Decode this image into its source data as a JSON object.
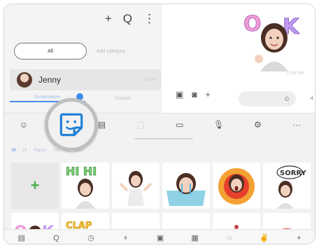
{
  "left_pane": {
    "top_actions": [
      "+",
      "Q",
      "⋮"
    ],
    "filter_pill": "All",
    "filter_link": "Add category",
    "contact": {
      "name": "Jenny",
      "time": "12:45"
    },
    "tabs": [
      "Conversations",
      "Contacts"
    ]
  },
  "right_pane": {
    "sent_time": "12:45 PM",
    "compose_icons": [
      "▣",
      "◙",
      "+"
    ],
    "input_icon": "☺",
    "send_icon": "⫞"
  },
  "keyboard": {
    "toolbar": [
      "☺",
      "",
      "▤",
      "▢",
      "▭",
      "🎙",
      "⚙",
      "···"
    ],
    "categories": [
      "All",
      "Hi",
      "Happy",
      "Yes",
      "Congrats"
    ],
    "add_label": "+",
    "bottom_bar": [
      "▤",
      "Q",
      "◷",
      "♀",
      "▣",
      "▦",
      "◌",
      "✌",
      "+"
    ]
  }
}
